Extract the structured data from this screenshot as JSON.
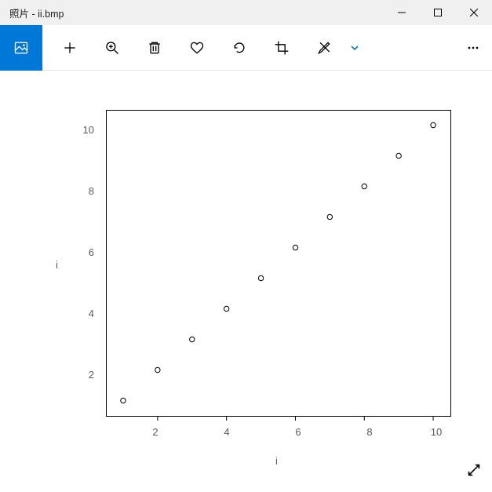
{
  "window": {
    "title": "照片 - ii.bmp"
  },
  "toolbar": {
    "view": "图片视图",
    "add": "添加",
    "zoom": "缩放",
    "delete": "删除",
    "like": "喜欢",
    "rotate": "旋转",
    "crop": "裁剪",
    "edit": "编辑",
    "more": "更多"
  },
  "chart_data": {
    "type": "scatter",
    "title": "",
    "xlabel": "i",
    "ylabel": "i",
    "xlim": [
      0.5,
      10.5
    ],
    "ylim": [
      0.5,
      10.5
    ],
    "xticks": [
      2,
      4,
      6,
      8,
      10
    ],
    "yticks": [
      2,
      4,
      6,
      8,
      10
    ],
    "series": [
      {
        "name": "i",
        "x": [
          1,
          2,
          3,
          4,
          5,
          6,
          7,
          8,
          9,
          10
        ],
        "y": [
          1,
          2,
          3,
          4,
          5,
          6,
          7,
          8,
          9,
          10
        ]
      }
    ]
  }
}
